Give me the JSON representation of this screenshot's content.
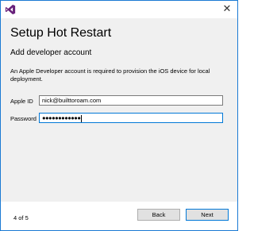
{
  "window": {
    "logo_icon": "visual-studio-logo-icon",
    "close_icon": "close-icon",
    "close_glyph": "✕",
    "accent_color": "#1a7ad4"
  },
  "page": {
    "title": "Setup Hot Restart",
    "subtitle": "Add developer account",
    "description": "An Apple Developer account is required to provision the iOS device for local deployment."
  },
  "form": {
    "apple_id_label": "Apple ID",
    "apple_id_value": "nick@builttoroam.com",
    "password_label": "Password",
    "password_value": "●●●●●●●●●●●●"
  },
  "footer": {
    "step": "4 of 5",
    "back_label": "Back",
    "next_label": "Next"
  }
}
